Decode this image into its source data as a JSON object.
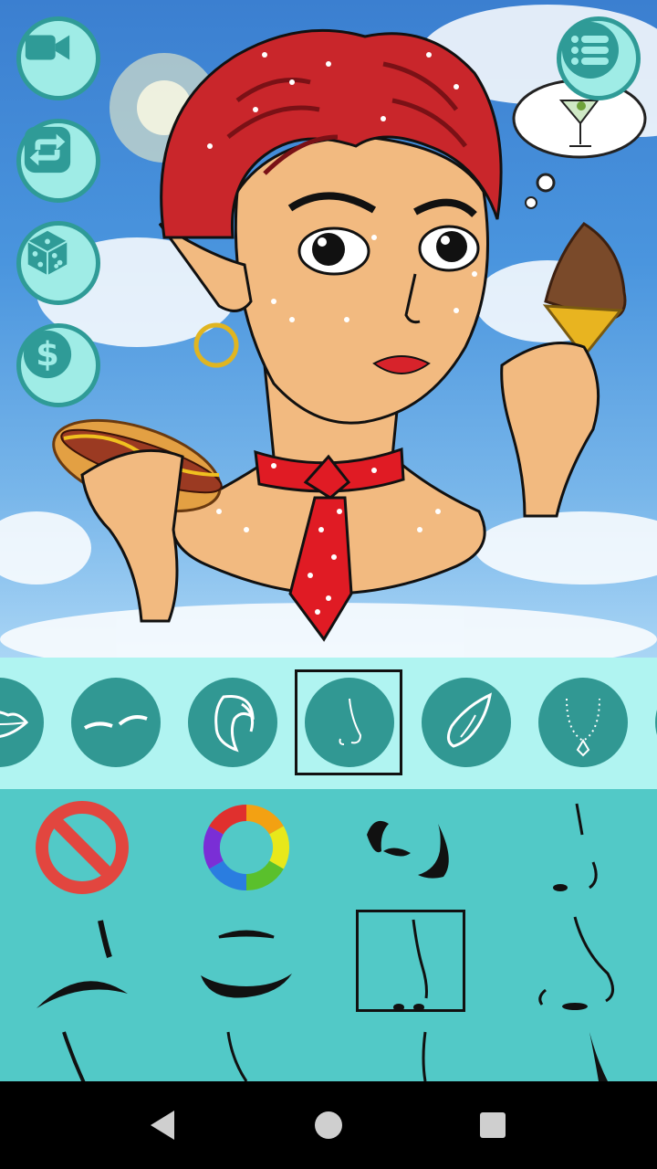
{
  "app": {
    "accent": "#2f9b97",
    "button_bg": "#9fece6",
    "category_bg": "#b0f4f1",
    "options_bg": "#52c9c7"
  },
  "left_actions": [
    {
      "name": "record-video-button",
      "icon": "video-camera-icon"
    },
    {
      "name": "swap-button",
      "icon": "repeat-icon"
    },
    {
      "name": "randomize-button",
      "icon": "dice-icon"
    },
    {
      "name": "shop-button",
      "icon": "dollar-icon",
      "symbol": "$"
    }
  ],
  "menu": {
    "icon": "list-menu-icon"
  },
  "categories": [
    {
      "id": "lips",
      "icon": "lips-icon"
    },
    {
      "id": "eyebrows",
      "icon": "eyebrows-icon"
    },
    {
      "id": "hair",
      "icon": "hair-icon"
    },
    {
      "id": "nose",
      "icon": "nose-icon",
      "selected": true
    },
    {
      "id": "ears",
      "icon": "elf-ear-icon"
    },
    {
      "id": "necklace",
      "icon": "necklace-icon"
    }
  ],
  "options": [
    {
      "id": "none",
      "icon": "prohibited-icon"
    },
    {
      "id": "color",
      "icon": "color-wheel-icon"
    },
    {
      "id": "nose-1",
      "icon": "nose-style-icon"
    },
    {
      "id": "nose-2",
      "icon": "nose-style-icon"
    },
    {
      "id": "nose-3",
      "icon": "nose-style-icon"
    },
    {
      "id": "nose-4",
      "icon": "nose-style-icon"
    },
    {
      "id": "nose-5",
      "icon": "nose-style-icon",
      "selected": true
    },
    {
      "id": "nose-6",
      "icon": "nose-style-icon"
    }
  ],
  "navbar": {
    "back_icon": "back-triangle-icon",
    "home_icon": "home-circle-icon",
    "recents_icon": "recents-square-icon"
  }
}
